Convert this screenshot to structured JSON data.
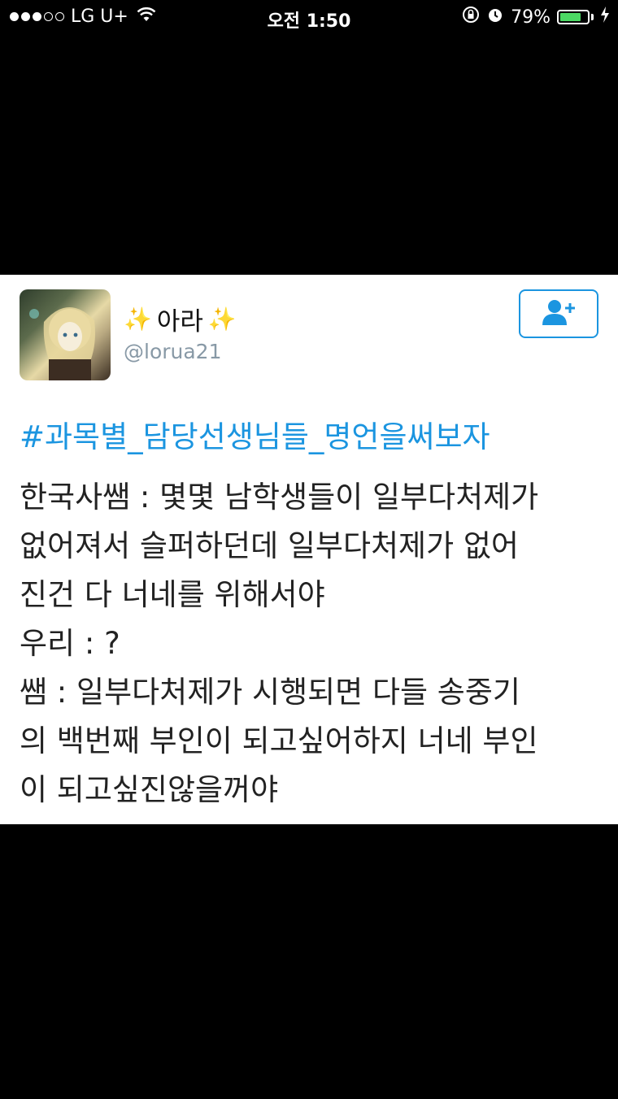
{
  "status_bar": {
    "carrier": "LG U+",
    "time": "오전 1:50",
    "battery_percent": "79%",
    "battery_level": 0.79,
    "accent_color": "#4cd964"
  },
  "tweet": {
    "display_name": "아라",
    "handle": "@lorua21",
    "follow_icon": "add-user-icon",
    "hashtag": "#과목별_담당선생님들_명언을써보자",
    "lines": [
      "한국사쌤 : 몇몇 남학생들이 일부다처제가",
      "없어져서 슬퍼하던데 일부다처제가 없어",
      "진건 다 너네를 위해서야",
      "우리 : ?",
      "쌤 : 일부다처제가 시행되면 다들 송중기",
      "의 백번째 부인이 되고싶어하지 너네 부인",
      "이 되고싶진않을꺼야"
    ],
    "link_color": "#1b95e0"
  }
}
